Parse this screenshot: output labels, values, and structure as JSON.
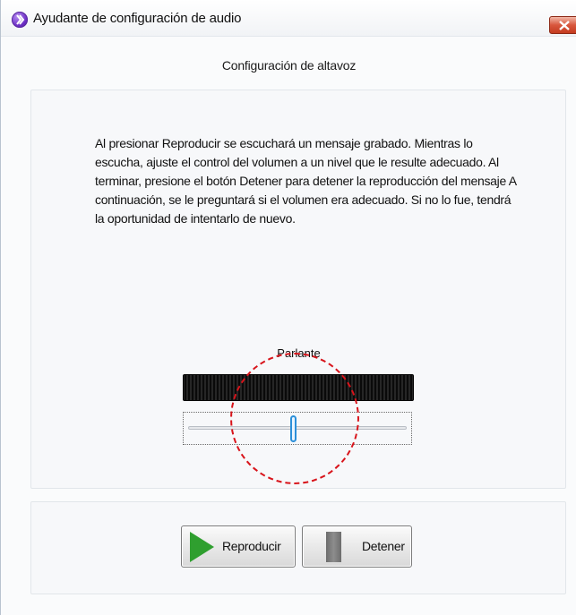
{
  "window": {
    "title": "Ayudante de configuración de audio",
    "close_label": "X"
  },
  "header": {
    "title": "Configuración de altavoz"
  },
  "instructions": {
    "text": "Al presionar Reproducir se escuchará un mensaje grabado. Mientras lo escucha, ajuste el control del volumen a un nivel que le resulte adecuado. Al terminar, presione el botón Detener para detener la reproducción del mensaje A continuación, se le preguntará si el volumen era adecuado. Si no lo fue, tendrá la oportunidad de intentarlo de nuevo."
  },
  "speaker": {
    "label": "Parlante",
    "volume_percent": 48
  },
  "buttons": {
    "play_label": "Reproducir",
    "stop_label": "Detener"
  },
  "icons": {
    "app": "app-logo-icon",
    "close": "close-icon",
    "play": "play-icon",
    "stop": "stop-icon"
  },
  "colors": {
    "annotation": "#d8141b",
    "play_icon": "#2f9f2f",
    "slider_thumb": "#2b8fd9",
    "close_button": "#d8573d"
  }
}
